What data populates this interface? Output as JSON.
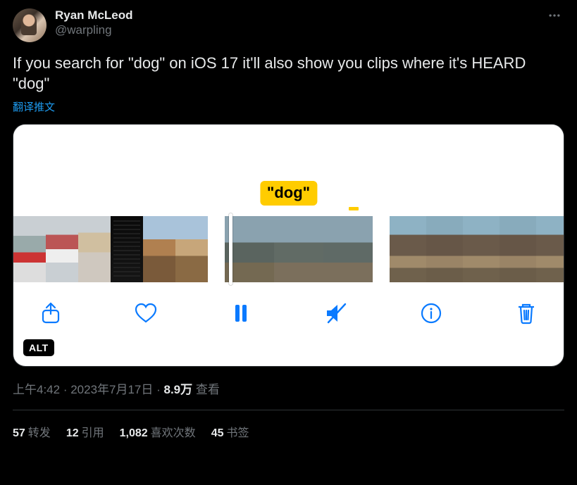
{
  "author": {
    "display_name": "Ryan McLeod",
    "handle": "@warpling"
  },
  "tweet": {
    "text": "If you search for \"dog\" on iOS 17 it'll also show you clips where it's HEARD \"dog\"",
    "translate_label": "翻译推文",
    "alt_badge": "ALT",
    "dog_chip": "\"dog\""
  },
  "meta": {
    "time": "上午4:42",
    "date": "2023年7月17日",
    "views_number": "8.9万",
    "views_label": "查看",
    "separator": " · "
  },
  "stats": {
    "retweets": {
      "count": "57",
      "label": "转发"
    },
    "quotes": {
      "count": "12",
      "label": "引用"
    },
    "likes": {
      "count": "1,082",
      "label": "喜欢次数"
    },
    "bookmarks": {
      "count": "45",
      "label": "书签"
    }
  },
  "icons": {
    "more": "more-icon",
    "share": "share-icon",
    "heart": "heart-icon",
    "pause": "pause-icon",
    "mute": "mute-icon",
    "info": "info-icon",
    "trash": "trash-icon"
  }
}
